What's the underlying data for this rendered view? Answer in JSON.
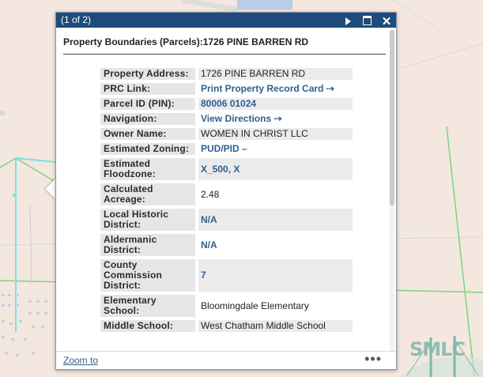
{
  "popup": {
    "counter": "(1 of 2)",
    "heading": "Property Boundaries (Parcels):1726 PINE BARREN RD",
    "rows": [
      {
        "label": "Property Address:",
        "value": "1726 PINE BARREN RD"
      },
      {
        "label": "PRC Link:",
        "value": "Print Property Record Card ⇢"
      },
      {
        "label": "Parcel ID (PIN):",
        "value": "80006 01024"
      },
      {
        "label": "Navigation:",
        "value": "View Directions ⇢"
      },
      {
        "label": "Owner Name:",
        "value": "WOMEN IN CHRIST LLC"
      },
      {
        "label": "Estimated Zoning:",
        "value": "PUD/PID –"
      },
      {
        "label": "Estimated Floodzone:",
        "value": "X_500, X"
      },
      {
        "label": "Calculated Acreage:",
        "value": "2.48"
      },
      {
        "label": "Local Historic District:",
        "value": "N/A"
      },
      {
        "label": "Aldermanic District:",
        "value": "N/A"
      },
      {
        "label": "County Commission District:",
        "value": "7"
      },
      {
        "label": "Elementary School:",
        "value": "Bloomingdale Elementary"
      },
      {
        "label": "Middle School:",
        "value": "West Chatham Middle School"
      }
    ],
    "footer": {
      "zoom_label": "Zoom to",
      "more_label": "•••"
    }
  },
  "logo": {
    "text": "SMLC"
  },
  "colors": {
    "titlebar": "#1f4b7c",
    "link": "#2f5f8e",
    "map_bg": "#f3e7df",
    "parcel_line": "#7fe0e0",
    "green_line": "#7ed37e"
  }
}
